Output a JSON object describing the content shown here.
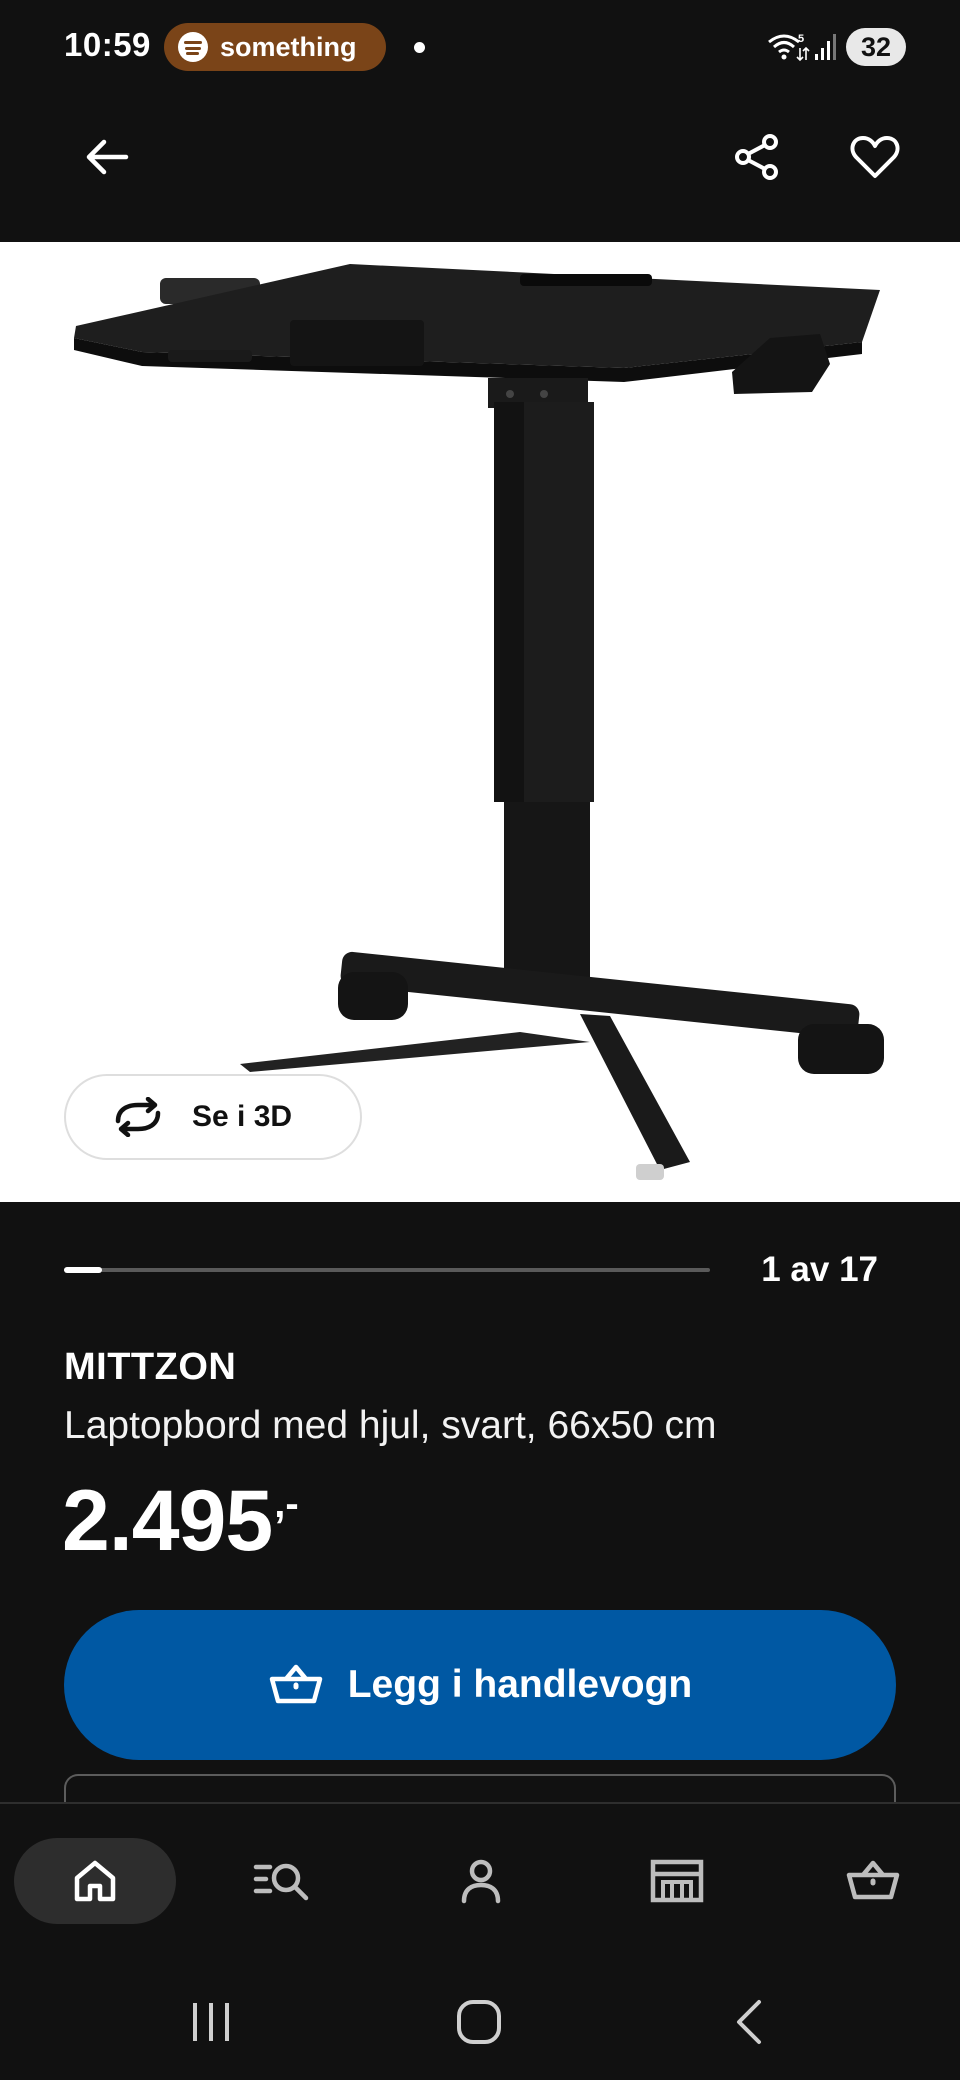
{
  "status_bar": {
    "time": "10:59",
    "media_label": "something",
    "wifi_badge": "5",
    "battery": "32"
  },
  "header": {
    "back_icon": "arrow-left-icon",
    "share_icon": "share-icon",
    "favorite_icon": "heart-icon"
  },
  "gallery": {
    "view_3d_label": "Se i 3D",
    "counter": "1 av 17",
    "current": 1,
    "total": 17
  },
  "product": {
    "name": "MITTZON",
    "description": "Laptopbord med hjul, svart, 66x50 cm",
    "price": "2.495",
    "price_suffix": ",-"
  },
  "actions": {
    "add_to_cart_label": "Legg i handlevogn"
  },
  "bottom_nav": {
    "items": [
      {
        "id": "home",
        "icon": "home-icon",
        "active": true
      },
      {
        "id": "search",
        "icon": "search-list-icon",
        "active": false
      },
      {
        "id": "profile",
        "icon": "person-icon",
        "active": false
      },
      {
        "id": "stores",
        "icon": "store-icon",
        "active": false
      },
      {
        "id": "cart",
        "icon": "basket-icon",
        "active": false
      }
    ]
  },
  "colors": {
    "background": "#111111",
    "primary_button": "#0058a3",
    "media_pill": "#7a4418",
    "active_nav": "#2d2d2d"
  }
}
